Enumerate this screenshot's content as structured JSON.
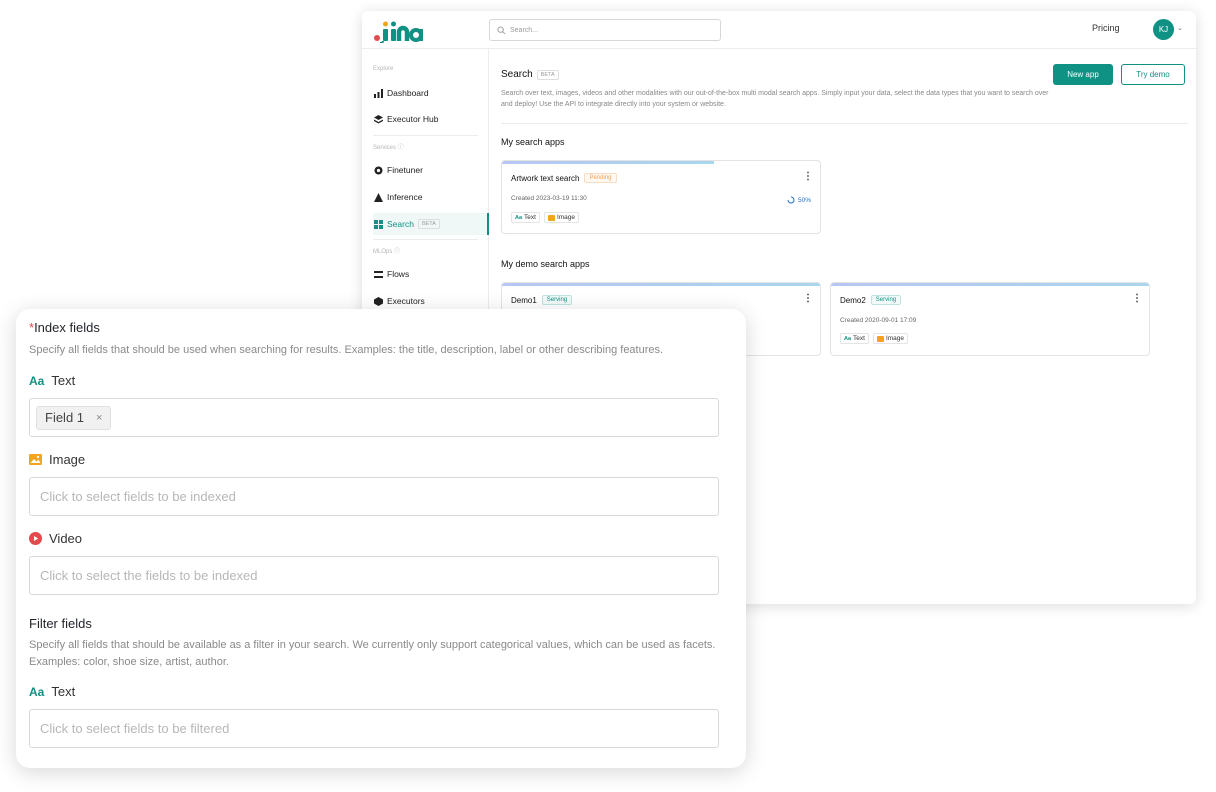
{
  "brand": {
    "logo_text": "jina",
    "accent": "#0f9183"
  },
  "topbar": {
    "search_placeholder": "Search...",
    "pricing": "Pricing",
    "avatar": "KJ"
  },
  "sidebar": {
    "explore_label": "Explore",
    "services_label": "Services ⓘ",
    "mlops_label": "MLOps ⓘ",
    "items": [
      {
        "label": "Dashboard",
        "icon": "bar-chart-icon"
      },
      {
        "label": "Executor Hub",
        "icon": "hub-icon"
      },
      {
        "label": "Finetuner",
        "icon": "finetuner-icon"
      },
      {
        "label": "Inference",
        "icon": "inference-icon"
      },
      {
        "label": "Search",
        "icon": "search-grid-icon",
        "tag": "BETA",
        "active": true
      },
      {
        "label": "Flows",
        "icon": "flows-icon"
      },
      {
        "label": "Executors",
        "icon": "executors-icon"
      }
    ]
  },
  "main": {
    "title": "Search",
    "title_tag": "BETA",
    "description": "Search over text, images, videos and other modalities with our out-of-the-box multi modal search apps. Simply input your data, select the data types that you want to search over and deploy! Use the API to integrate directly into your system or website.",
    "new_app": "New app",
    "try_demo": "Try demo",
    "my_apps_title": "My search apps",
    "demo_apps_title": "My demo search apps",
    "apps": [
      {
        "name": "Artwork text search",
        "status": "Pending",
        "created": "Created 2023-03-19 11:30",
        "progress": "50%",
        "progress_value": 50,
        "tags": [
          "Text",
          "Image"
        ]
      }
    ],
    "demo_apps": [
      {
        "name": "Demo1",
        "status": "Serving"
      },
      {
        "name": "Demo2",
        "status": "Serving",
        "created": "Created 2020-09-01 17:09",
        "tags": [
          "Text",
          "Image"
        ]
      }
    ]
  },
  "form": {
    "required_mark": "*",
    "index_title": "Index fields",
    "index_desc": "Specify all fields that should be used when searching for results. Examples: the title, description, label or other describing features.",
    "text_label": "Text",
    "text_chip": "Field 1",
    "chip_remove": "×",
    "image_label": "Image",
    "image_placeholder": "Click to select fields to be indexed",
    "video_label": "Video",
    "video_placeholder": "Click to select the fields to be indexed",
    "filter_title": "Filter fields",
    "filter_desc": "Specify all fields that should be available as a filter in your search. We currently only support categorical values, which can be used as facets. Examples: color, shoe size, artist, author.",
    "filter_text_label": "Text",
    "filter_placeholder": "Click to select fields to be filtered",
    "aa_glyph": "Aa"
  }
}
